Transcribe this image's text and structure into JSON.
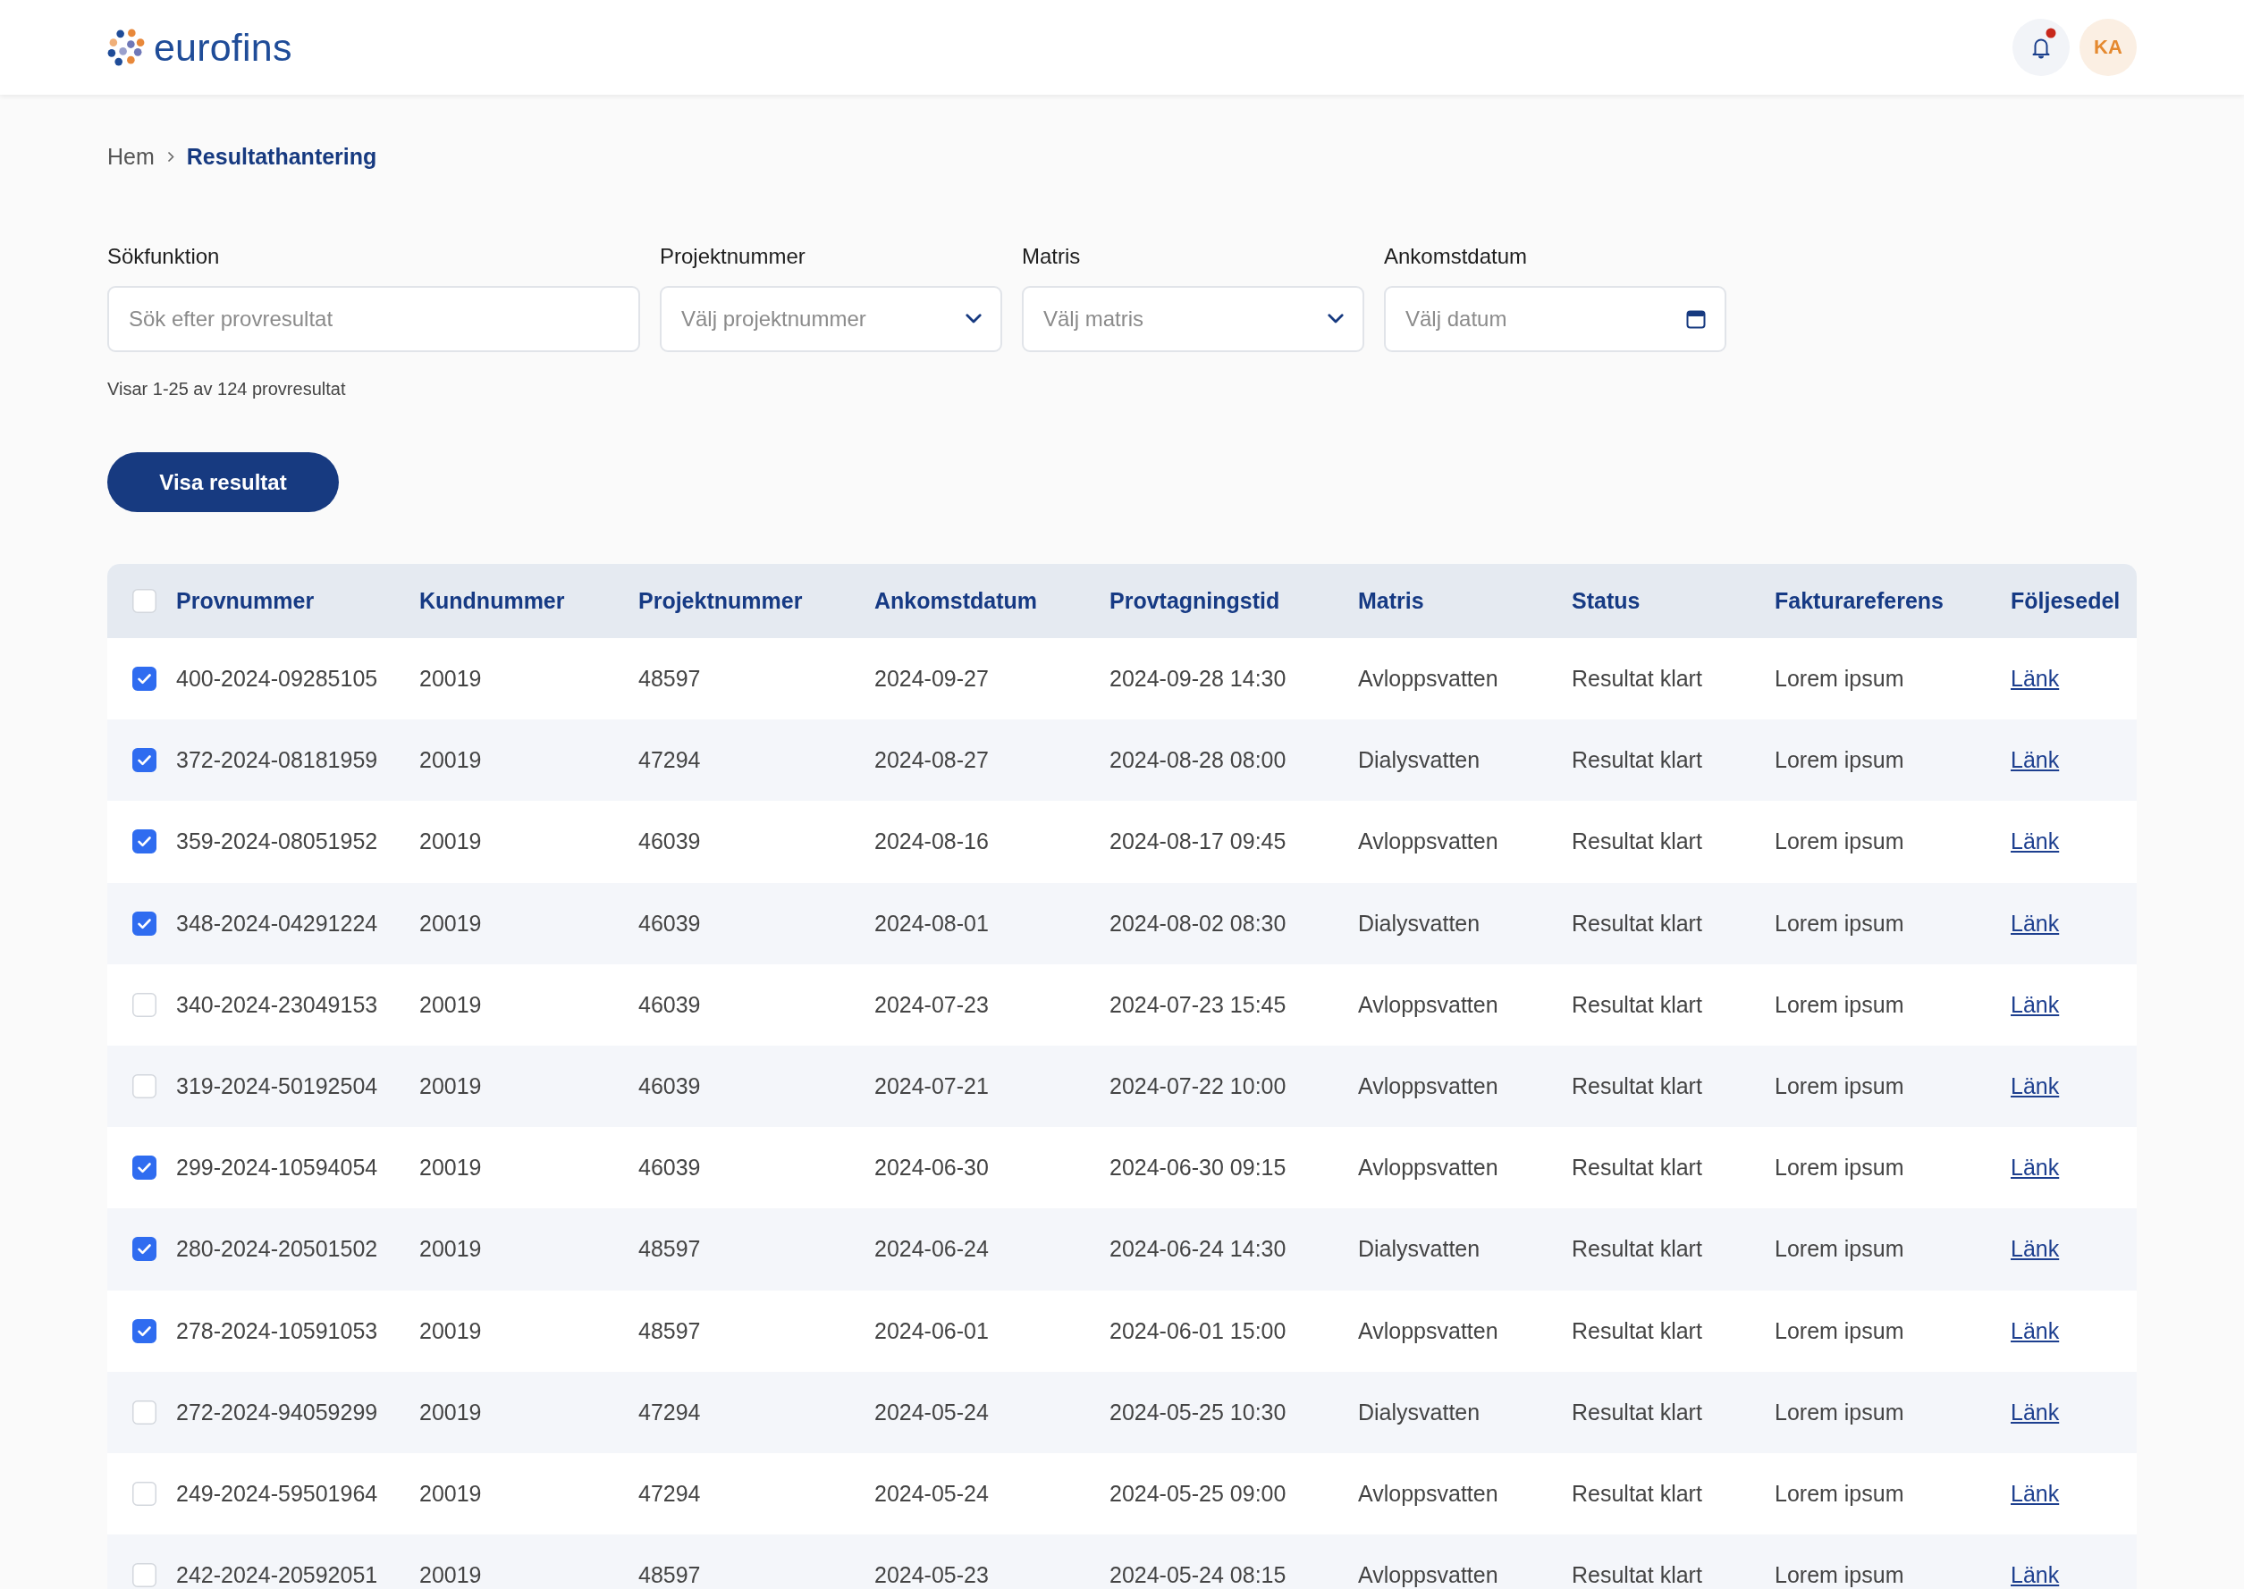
{
  "header": {
    "logo_text": "eurofins",
    "notifications": {
      "unread": true
    },
    "avatar": {
      "initials": "KA"
    }
  },
  "breadcrumb": [
    {
      "label": "Hem",
      "current": false
    },
    {
      "label": "Resultathantering",
      "current": true
    }
  ],
  "filters": [
    {
      "kind": "text",
      "label": "Sökfunktion",
      "placeholder": "Sök efter provresultat"
    },
    {
      "kind": "select",
      "label": "Projektnummer",
      "placeholder": "Välj projektnummer"
    },
    {
      "kind": "select",
      "label": "Matris",
      "placeholder": "Välj matris"
    },
    {
      "kind": "date",
      "label": "Ankomstdatum",
      "placeholder": "Välj datum"
    }
  ],
  "result_count": "Visar 1-25 av 124 provresultat",
  "show_button": "Visa resultat",
  "table": {
    "select_all": {
      "checked": false
    },
    "columns": [
      "Provnummer",
      "Kundnummer",
      "Projektnummer",
      "Ankomstdatum",
      "Provtagningstid",
      "Matris",
      "Status",
      "Fakturareferens",
      "Följesedel"
    ],
    "rows": [
      {
        "checked": true,
        "cells": [
          "400-2024-09285105",
          "20019",
          "48597",
          "2024-09-27",
          "2024-09-28 14:30",
          "Avloppsvatten",
          "Resultat klart",
          "Lorem ipsum"
        ],
        "link": "Länk"
      },
      {
        "checked": true,
        "cells": [
          "372-2024-08181959",
          "20019",
          "47294",
          "2024-08-27",
          "2024-08-28 08:00",
          "Dialysvatten",
          "Resultat klart",
          "Lorem ipsum"
        ],
        "link": "Länk"
      },
      {
        "checked": true,
        "cells": [
          "359-2024-08051952",
          "20019",
          "46039",
          "2024-08-16",
          "2024-08-17 09:45",
          "Avloppsvatten",
          "Resultat klart",
          "Lorem ipsum"
        ],
        "link": "Länk"
      },
      {
        "checked": true,
        "cells": [
          "348-2024-04291224",
          "20019",
          "46039",
          "2024-08-01",
          "2024-08-02 08:30",
          "Dialysvatten",
          "Resultat klart",
          "Lorem ipsum"
        ],
        "link": "Länk"
      },
      {
        "checked": false,
        "cells": [
          "340-2024-23049153",
          "20019",
          "46039",
          "2024-07-23",
          "2024-07-23 15:45",
          "Avloppsvatten",
          "Resultat klart",
          "Lorem ipsum"
        ],
        "link": "Länk"
      },
      {
        "checked": false,
        "cells": [
          "319-2024-50192504",
          "20019",
          "46039",
          "2024-07-21",
          "2024-07-22 10:00",
          "Avloppsvatten",
          "Resultat klart",
          "Lorem ipsum"
        ],
        "link": "Länk"
      },
      {
        "checked": true,
        "cells": [
          "299-2024-10594054",
          "20019",
          "46039",
          "2024-06-30",
          "2024-06-30 09:15",
          "Avloppsvatten",
          "Resultat klart",
          "Lorem ipsum"
        ],
        "link": "Länk"
      },
      {
        "checked": true,
        "cells": [
          "280-2024-20501502",
          "20019",
          "48597",
          "2024-06-24",
          "2024-06-24 14:30",
          "Dialysvatten",
          "Resultat klart",
          "Lorem ipsum"
        ],
        "link": "Länk"
      },
      {
        "checked": true,
        "cells": [
          "278-2024-10591053",
          "20019",
          "48597",
          "2024-06-01",
          "2024-06-01 15:00",
          "Avloppsvatten",
          "Resultat klart",
          "Lorem ipsum"
        ],
        "link": "Länk"
      },
      {
        "checked": false,
        "cells": [
          "272-2024-94059299",
          "20019",
          "47294",
          "2024-05-24",
          "2024-05-25 10:30",
          "Dialysvatten",
          "Resultat klart",
          "Lorem ipsum"
        ],
        "link": "Länk"
      },
      {
        "checked": false,
        "cells": [
          "249-2024-59501964",
          "20019",
          "47294",
          "2024-05-24",
          "2024-05-25 09:00",
          "Avloppsvatten",
          "Resultat klart",
          "Lorem ipsum"
        ],
        "link": "Länk"
      },
      {
        "checked": false,
        "cells": [
          "242-2024-20592051",
          "20019",
          "48597",
          "2024-05-23",
          "2024-05-24 08:15",
          "Avloppsvatten",
          "Resultat klart",
          "Lorem ipsum"
        ],
        "link": "Länk"
      }
    ]
  }
}
